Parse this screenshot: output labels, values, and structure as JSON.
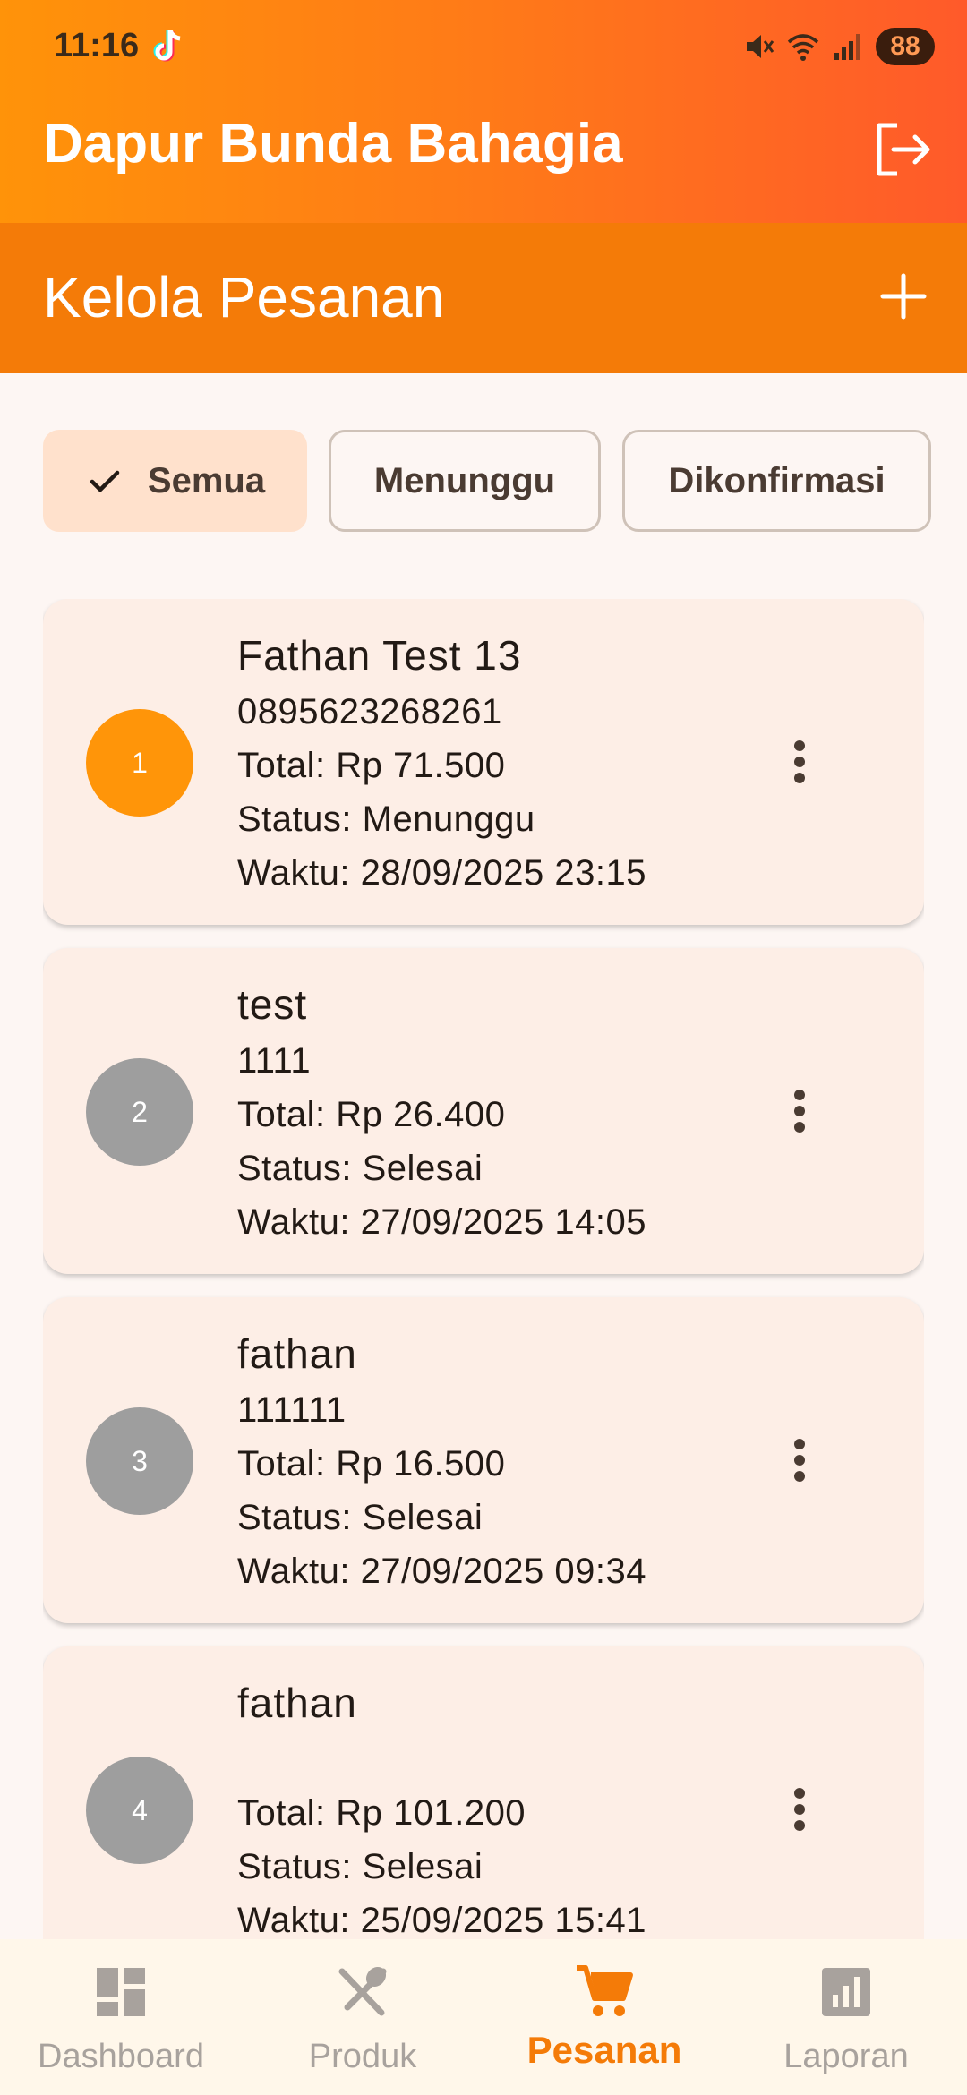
{
  "status_bar": {
    "time": "11:16",
    "battery": "88"
  },
  "header": {
    "app_title": "Dapur Bunda Bahagia"
  },
  "page": {
    "title": "Kelola Pesanan"
  },
  "filters": [
    {
      "label": "Semua",
      "selected": true
    },
    {
      "label": "Menunggu",
      "selected": false
    },
    {
      "label": "Dikonfirmasi",
      "selected": false
    }
  ],
  "orders": [
    {
      "number": "1",
      "name": "Fathan Test 13",
      "phone": "0895623268261",
      "total": "Total: Rp 71.500",
      "status": "Status: Menunggu",
      "time": "Waktu: 28/09/2025 23:15",
      "avatar_color": "#ff9509"
    },
    {
      "number": "2",
      "name": "test",
      "phone": "1111",
      "total": "Total: Rp 26.400",
      "status": "Status: Selesai",
      "time": "Waktu: 27/09/2025 14:05",
      "avatar_color": "#9e9e9e"
    },
    {
      "number": "3",
      "name": "fathan",
      "phone": "111111",
      "total": "Total: Rp 16.500",
      "status": "Status: Selesai",
      "time": "Waktu: 27/09/2025 09:34",
      "avatar_color": "#9e9e9e"
    },
    {
      "number": "4",
      "name": "fathan",
      "phone": "",
      "total": "Total: Rp 101.200",
      "status": "Status: Selesai",
      "time": "Waktu: 25/09/2025 15:41",
      "avatar_color": "#9e9e9e"
    }
  ],
  "bottom_nav": [
    {
      "label": "Dashboard",
      "icon": "dashboard-icon",
      "active": false
    },
    {
      "label": "Produk",
      "icon": "utensils-icon",
      "active": false
    },
    {
      "label": "Pesanan",
      "icon": "cart-icon",
      "active": true
    },
    {
      "label": "Laporan",
      "icon": "report-icon",
      "active": false
    }
  ],
  "colors": {
    "accent": "#f47b08",
    "header_start": "#ff9309",
    "header_end": "#ff5a2a",
    "card_bg": "#fdeee6",
    "chip_selected": "#ffe1cc"
  }
}
